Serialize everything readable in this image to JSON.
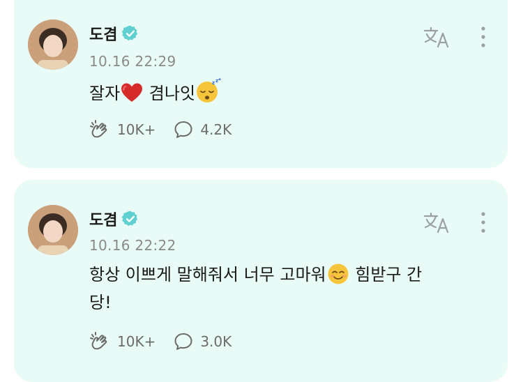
{
  "posts": [
    {
      "author": "도겸",
      "timestamp": "10.16 22:29",
      "text_parts": [
        "잘자",
        " 겸나잇"
      ],
      "emoji": [
        "red-heart",
        "sleeping-face"
      ],
      "likes": "10K+",
      "comments": "4.2K"
    },
    {
      "author": "도겸",
      "timestamp": "10.16 22:22",
      "text_line1": "항상 이쁘게 말해줘서 너무 고마워",
      "text_line1_tail": " 힘받구 간",
      "text_line2": "당!",
      "emoji": [
        "smiling-face"
      ],
      "likes": "10K+",
      "comments": "3.0K"
    }
  ],
  "icons": {
    "verified": "verified-badge-icon",
    "translate": "translate-icon",
    "more": "more-vertical-icon",
    "like": "cheer-hand-icon",
    "comment": "comment-bubble-icon"
  },
  "colors": {
    "card_bg": "#e9fbf7",
    "verified": "#5fd0cf",
    "icon_gray": "#9aa0a0",
    "timestamp": "#8a8a8a"
  }
}
